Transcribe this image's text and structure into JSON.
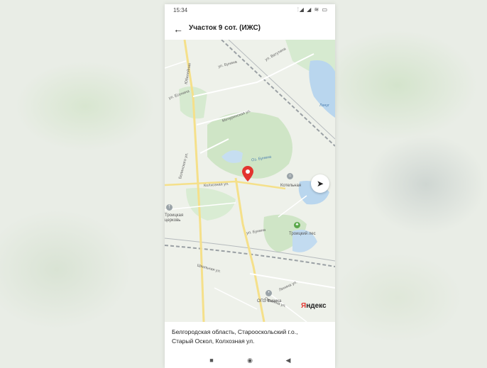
{
  "status_bar": {
    "time": "15:34",
    "icons": "⫶◢ ◢ ≋ ▭"
  },
  "header": {
    "back_icon": "←",
    "title": "Участок 9 сот. (ИЖС)"
  },
  "map": {
    "streets": [
      "ул. Ватутина",
      "ул. Бунина",
      "Юбилейная",
      "ул. Есенина",
      "Мичуринская ул.",
      "Белинского ул.",
      "Колхозная ул.",
      "ул. Бунина",
      "Школьная ул.",
      "Ленина ул.",
      "Пушкина ул."
    ],
    "water_labels": [
      "Лачуг",
      "Оз. Бунина"
    ],
    "pois": [
      {
        "label": "Котельная",
        "icon": "building-icon"
      },
      {
        "label": "Троицкий лес",
        "icon": "forest-icon"
      },
      {
        "label": "Троицкая церковь",
        "icon": "church-icon"
      },
      {
        "label": "ОПЗ Физика",
        "icon": "place-icon"
      }
    ],
    "logo": {
      "first_letter": "Я",
      "rest": "ндекс"
    },
    "colors": {
      "background": "#eef1ea",
      "forest": "#cfe5c6",
      "water": "#b9d6ee",
      "road_yellow": "#f5e08a",
      "pin": "#e3342f"
    }
  },
  "address": {
    "line1": "Белгородская область, Старооскольский г.о.,",
    "line2": "Старый Оскол, Колхозная ул."
  },
  "nav": {
    "recents_icon": "■",
    "home_icon": "◉",
    "back_icon": "◀"
  }
}
